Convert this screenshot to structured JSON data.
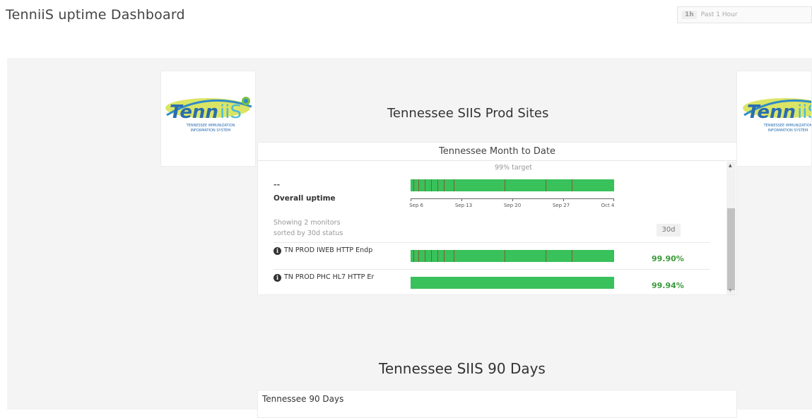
{
  "dashboard": {
    "title": "TenniiS uptime Dashboard",
    "time_range": {
      "abbr": "1h",
      "label": "Past 1 Hour"
    }
  },
  "logo": {
    "word_part1": "Tenn",
    "word_part2": "iiS",
    "tagline_line1": "TENNESSEE IMMUNIZATION",
    "tagline_line2": "INFORMATION SYSTEM"
  },
  "sections": [
    {
      "title": "Tennessee SIIS Prod Sites"
    },
    {
      "title": "Tennessee SIIS 90 Days"
    }
  ],
  "month_widget": {
    "title": "Tennessee Month to Date",
    "target": "99% target",
    "summary_value": "--",
    "overall_label": "Overall uptime",
    "axis_ticks": [
      "Sep 6",
      "Sep 13",
      "Sep 20",
      "Sep 27",
      "Oct 4"
    ],
    "showing_line1": "Showing 2 monitors",
    "showing_line2": "sorted by 30d status",
    "period": "30d",
    "monitors": [
      {
        "name": "TN PROD IWEB HTTP Endp",
        "uptime": "99.90%"
      },
      {
        "name": "TN PROD PHC HL7 HTTP Er",
        "uptime": "99.94%"
      }
    ]
  },
  "days90_widget": {
    "title": "Tennessee 90 Days"
  },
  "colors": {
    "uptime_green": "#39c15b",
    "percent_green": "#3a9a3a",
    "incident_mark": "#8a5a30"
  }
}
